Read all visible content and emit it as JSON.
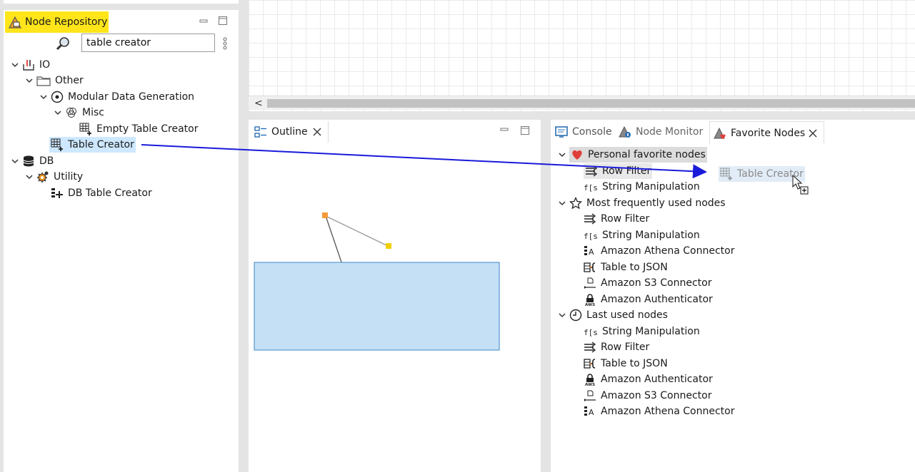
{
  "node_repository": {
    "title": "Node Repository",
    "search_value": "table creator",
    "tree": {
      "io": "IO",
      "other": "Other",
      "modular": "Modular Data Generation",
      "misc": "Misc",
      "empty_table_creator": "Empty Table Creator",
      "table_creator": "Table Creator",
      "db": "DB",
      "utility": "Utility",
      "db_table_creator": "DB Table Creator"
    }
  },
  "outline": {
    "title": "Outline"
  },
  "editor": {
    "scroll_left": "<"
  },
  "bottom_tabs": {
    "console": "Console",
    "node_monitor": "Node Monitor",
    "favorite_nodes": "Favorite Nodes"
  },
  "favorites": {
    "personal": {
      "label": "Personal favorite nodes",
      "items": [
        "Row Filter",
        "String Manipulation"
      ]
    },
    "frequent": {
      "label": "Most frequently used nodes",
      "items": [
        "Row Filter",
        "String Manipulation",
        "Amazon Athena Connector",
        "Table to JSON",
        "Amazon S3 Connector",
        "Amazon Authenticator"
      ]
    },
    "last": {
      "label": "Last used nodes",
      "items": [
        "String Manipulation",
        "Row Filter",
        "Table to JSON",
        "Amazon Authenticator",
        "Amazon S3 Connector",
        "Amazon Athena Connector"
      ]
    }
  },
  "drag_ghost": {
    "label": "Table Creator"
  },
  "colors": {
    "accent_yellow": "#ffe51a",
    "selection": "#cde8ff",
    "arrow": "#1a1adb",
    "outline_view": "#c5e0f5"
  }
}
